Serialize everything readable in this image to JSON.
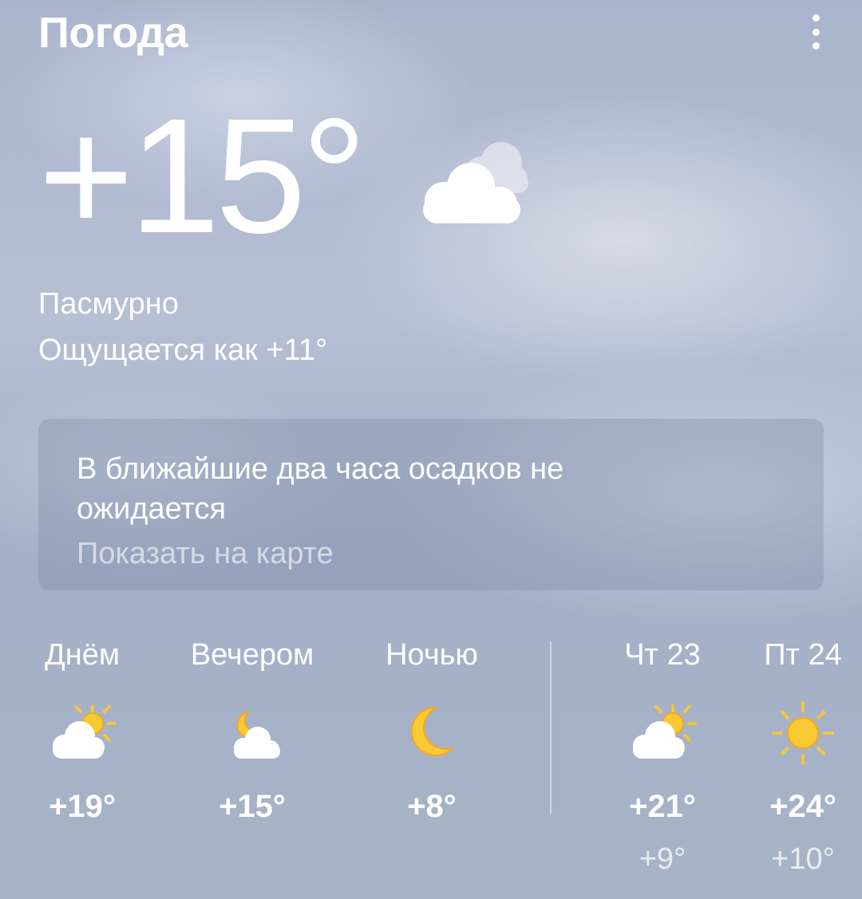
{
  "app": {
    "title": "Погода",
    "menu_icon": "more-vert-icon"
  },
  "current": {
    "temperature": "+15°",
    "condition": "Пасмурно",
    "feels_like": "Ощущается как +11°",
    "icon": "cloudy-icon"
  },
  "precipitation": {
    "text": "В ближайшие два часа осадков не ожидается",
    "map_link": "Показать на карте"
  },
  "today_parts": [
    {
      "label": "Днём",
      "temp": "+19°",
      "icon": "partly-cloudy-day-icon"
    },
    {
      "label": "Вечером",
      "temp": "+15°",
      "icon": "partly-cloudy-night-icon"
    },
    {
      "label": "Ночью",
      "temp": "+8°",
      "icon": "moon-icon"
    }
  ],
  "days": [
    {
      "label": "Чт 23",
      "temp_day": "+21°",
      "temp_night": "+9°",
      "icon": "partly-cloudy-day-icon"
    },
    {
      "label": "Пт 24",
      "temp_day": "+24°",
      "temp_night": "+10°",
      "icon": "sun-icon"
    }
  ]
}
